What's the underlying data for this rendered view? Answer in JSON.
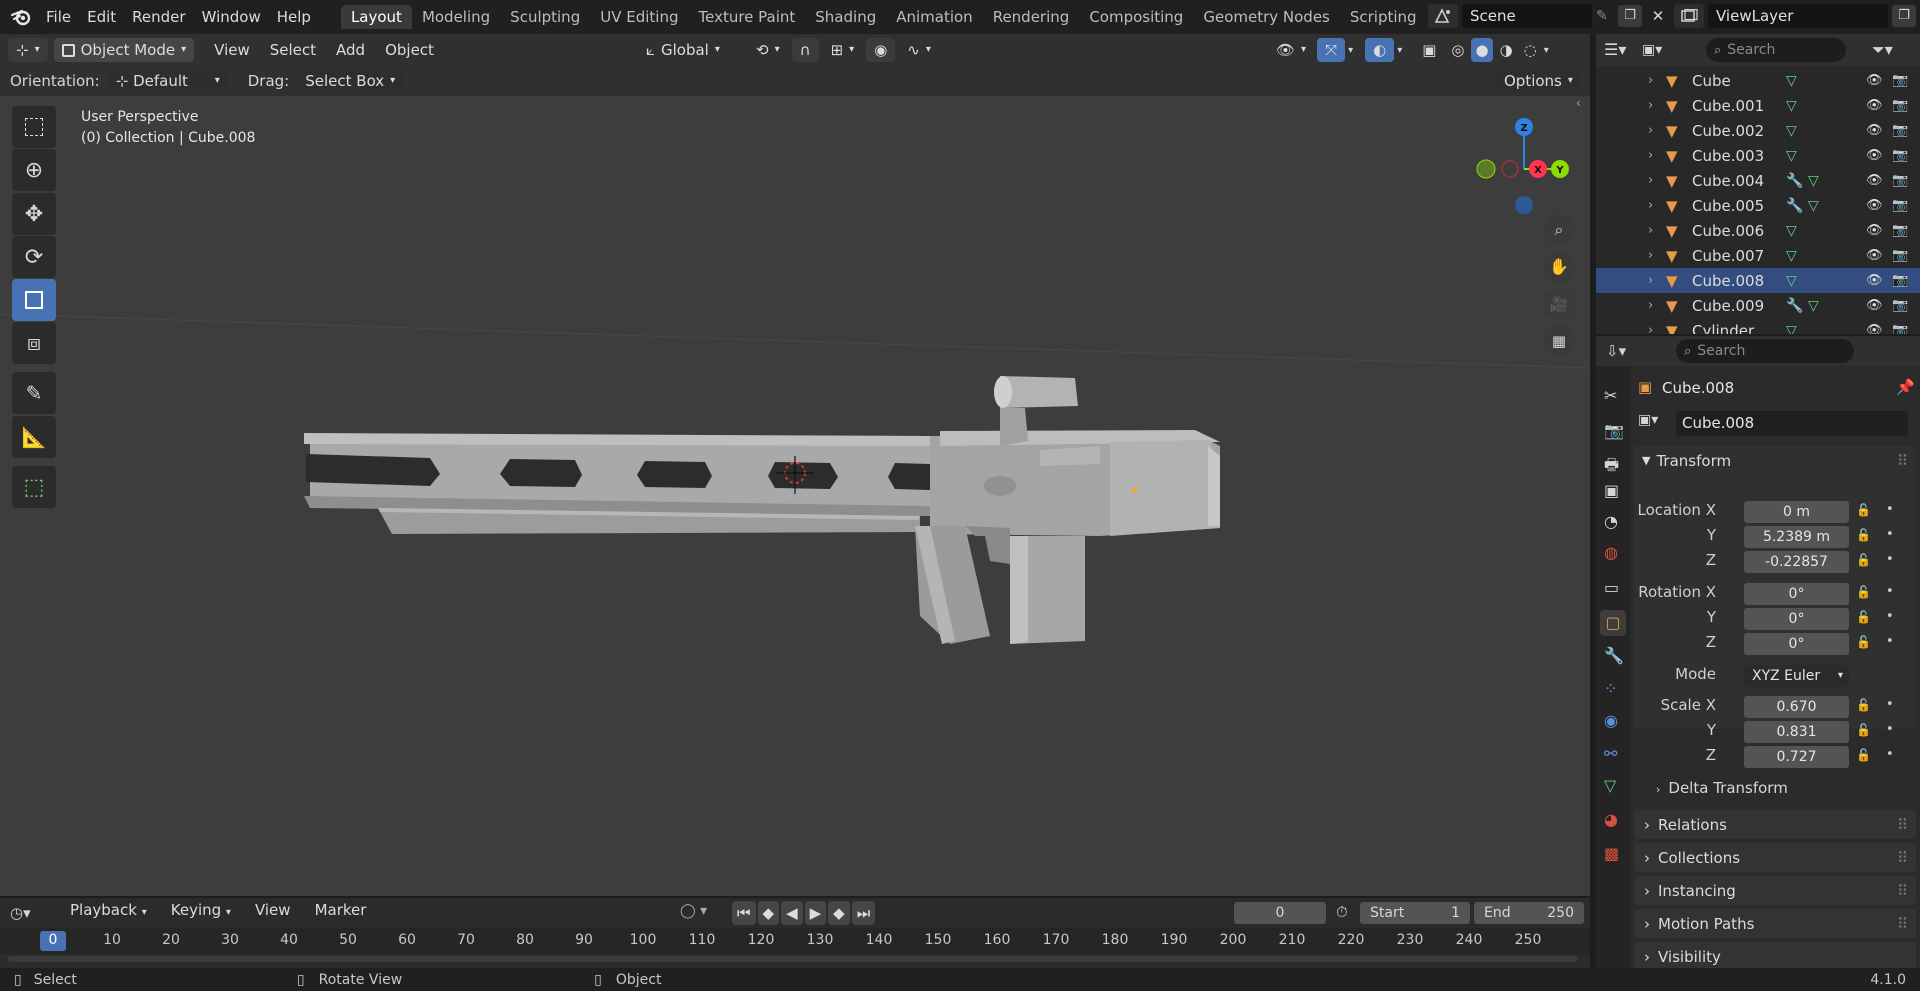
{
  "topbar": {
    "menus": [
      "File",
      "Edit",
      "Render",
      "Window",
      "Help"
    ],
    "workspaces": [
      "Layout",
      "Modeling",
      "Sculpting",
      "UV Editing",
      "Texture Paint",
      "Shading",
      "Animation",
      "Rendering",
      "Compositing",
      "Geometry Nodes",
      "Scripting"
    ],
    "active_workspace": "Layout",
    "add_tab": "+",
    "scene": "Scene",
    "view_layer": "ViewLayer"
  },
  "viewport_header": {
    "mode": "Object Mode",
    "menus": [
      "View",
      "Select",
      "Add",
      "Object"
    ],
    "transform_orientation": "Global",
    "options": "Options"
  },
  "viewport_subheader": {
    "orientation_label": "Orientation:",
    "orientation_value": "Default",
    "drag_label": "Drag:",
    "drag_value": "Select Box"
  },
  "viewport": {
    "perspective": "User Perspective",
    "collection_info": "(0) Collection | Cube.008",
    "gizmo": {
      "z": "Z",
      "x": "X",
      "y": "Y"
    }
  },
  "outliner": {
    "search_placeholder": "Search",
    "items": [
      {
        "name": "Cube",
        "modifier": false
      },
      {
        "name": "Cube.001",
        "modifier": false
      },
      {
        "name": "Cube.002",
        "modifier": false
      },
      {
        "name": "Cube.003",
        "modifier": false
      },
      {
        "name": "Cube.004",
        "modifier": true
      },
      {
        "name": "Cube.005",
        "modifier": true
      },
      {
        "name": "Cube.006",
        "modifier": false
      },
      {
        "name": "Cube.007",
        "modifier": false
      },
      {
        "name": "Cube.008",
        "modifier": false
      },
      {
        "name": "Cube.009",
        "modifier": true
      },
      {
        "name": "Cylinder",
        "modifier": false
      }
    ],
    "selected": "Cube.008"
  },
  "properties": {
    "search_placeholder": "Search",
    "object_name": "Cube.008",
    "datablock_name": "Cube.008",
    "transform_title": "Transform",
    "location_label": "Location X",
    "location": {
      "x": "0 m",
      "y": "5.2389 m",
      "z": "-0.22857"
    },
    "rotation_label": "Rotation X",
    "rotation": {
      "x": "0°",
      "y": "0°",
      "z": "0°"
    },
    "mode_label": "Mode",
    "mode_value": "XYZ Euler",
    "scale_label": "Scale X",
    "scale": {
      "x": "0.670",
      "y": "0.831",
      "z": "0.727"
    },
    "axis_y": "Y",
    "axis_z": "Z",
    "delta_transform": "Delta Transform",
    "panels": [
      "Relations",
      "Collections",
      "Instancing",
      "Motion Paths",
      "Visibility"
    ]
  },
  "timeline": {
    "menus": [
      "Playback",
      "Keying",
      "View",
      "Marker"
    ],
    "current_frame": "0",
    "start_label": "Start",
    "start": "1",
    "end_label": "End",
    "end": "250",
    "ticks": [
      "0",
      "10",
      "20",
      "30",
      "40",
      "50",
      "60",
      "70",
      "80",
      "90",
      "100",
      "110",
      "120",
      "130",
      "140",
      "150",
      "160",
      "170",
      "180",
      "190",
      "200",
      "210",
      "220",
      "230",
      "240",
      "250"
    ]
  },
  "statusbar": {
    "select": "Select",
    "rotate_view": "Rotate View",
    "object": "Object",
    "version": "4.1.0"
  },
  "colors": {
    "accent": "#4772b3",
    "object_orange": "#e79a4a",
    "mesh_green": "#5fcf86",
    "modifier_blue": "#7a9fe0",
    "gizmo_x": "#ff3352",
    "gizmo_y": "#8bdc00",
    "gizmo_z": "#2f83e3"
  }
}
